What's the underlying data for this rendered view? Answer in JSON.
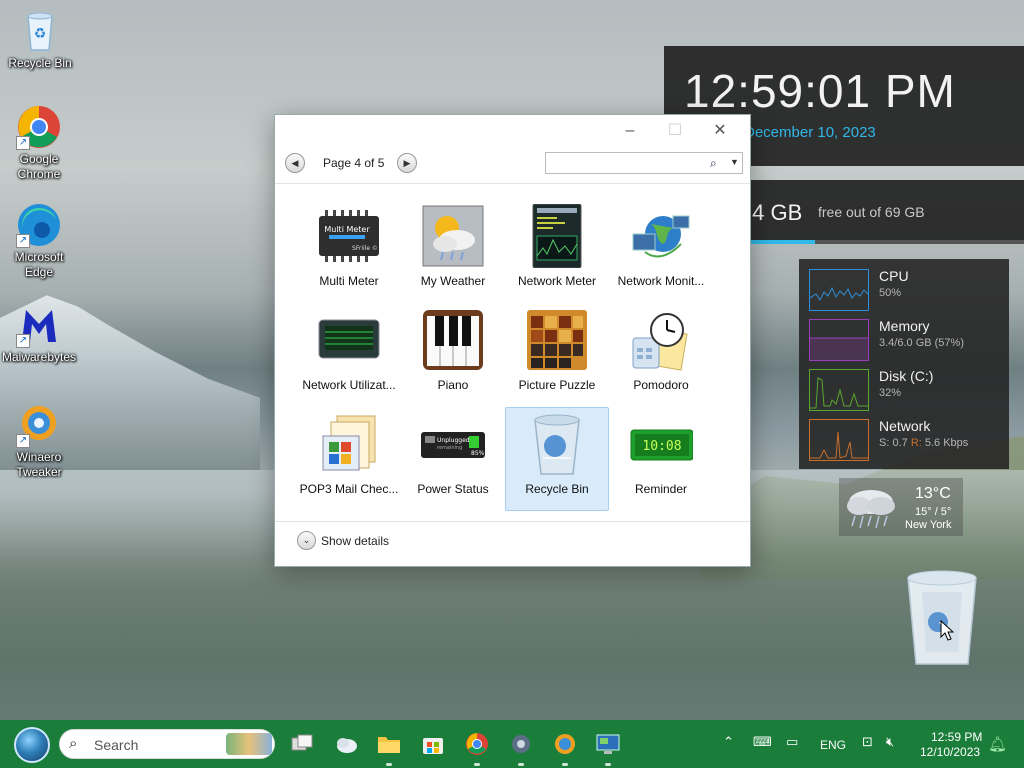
{
  "desktop": {
    "icons": [
      {
        "label": "Recycle Bin"
      },
      {
        "label": "Google Chrome"
      },
      {
        "label": "Microsoft Edge"
      },
      {
        "label": "Malwarebytes"
      },
      {
        "label": "Winaero Tweaker"
      }
    ]
  },
  "clock_widget": {
    "time": "12:59:01 PM",
    "date": "December 10, 2023"
  },
  "disk_widget": {
    "free_value": ".4 GB",
    "free_text": "free out of 69 GB",
    "bar_fraction": 0.42
  },
  "perf_widget": {
    "rows": [
      {
        "name": "CPU",
        "value": "50%",
        "color": "#2f8fd8"
      },
      {
        "name": "Memory",
        "value": "3.4/6.0 GB (57%)",
        "color": "#9b3fb8"
      },
      {
        "name": "Disk (C:)",
        "value": "32%",
        "color": "#5aa82e"
      },
      {
        "name": "Network",
        "value_s": "S: 0.7",
        "value_r_label": "R:",
        "value_r": "5.6 Kbps",
        "color": "#c8702c"
      }
    ]
  },
  "weather_widget": {
    "temp": "13°C",
    "range": "15° / 5°",
    "city": "New York"
  },
  "gadget_window": {
    "page_label": "Page 4 of 5",
    "search_placeholder": "",
    "gadgets": [
      {
        "label": "Multi Meter",
        "icon": "multi-meter-icon",
        "selected": false
      },
      {
        "label": "My Weather",
        "icon": "weather-icon",
        "selected": false
      },
      {
        "label": "Network Meter",
        "icon": "network-meter-icon",
        "selected": false
      },
      {
        "label": "Network Monit...",
        "icon": "network-monitor-icon",
        "selected": false
      },
      {
        "label": "Network Utilizat...",
        "icon": "network-utilization-icon",
        "selected": false
      },
      {
        "label": "Piano",
        "icon": "piano-icon",
        "selected": false
      },
      {
        "label": "Picture Puzzle",
        "icon": "picture-puzzle-icon",
        "selected": false
      },
      {
        "label": "Pomodoro",
        "icon": "pomodoro-icon",
        "selected": false
      },
      {
        "label": "POP3 Mail Chec...",
        "icon": "mail-icon",
        "selected": false
      },
      {
        "label": "Power Status",
        "icon": "power-status-icon",
        "selected": false
      },
      {
        "label": "Recycle Bin",
        "icon": "recycle-bin-icon",
        "selected": true
      },
      {
        "label": "Reminder",
        "icon": "reminder-icon",
        "selected": false
      }
    ],
    "multi_meter_text": "Multi Meter",
    "multi_meter_brand": "SFriile ©",
    "power_status_text": "Unplugged",
    "power_status_sub": "remaining",
    "power_status_pct": "85%",
    "reminder_time": "10:08",
    "details_label": "Show details"
  },
  "taskbar": {
    "search_placeholder": "Search",
    "language": "ENG",
    "time": "12:59 PM",
    "date": "12/10/2023"
  }
}
